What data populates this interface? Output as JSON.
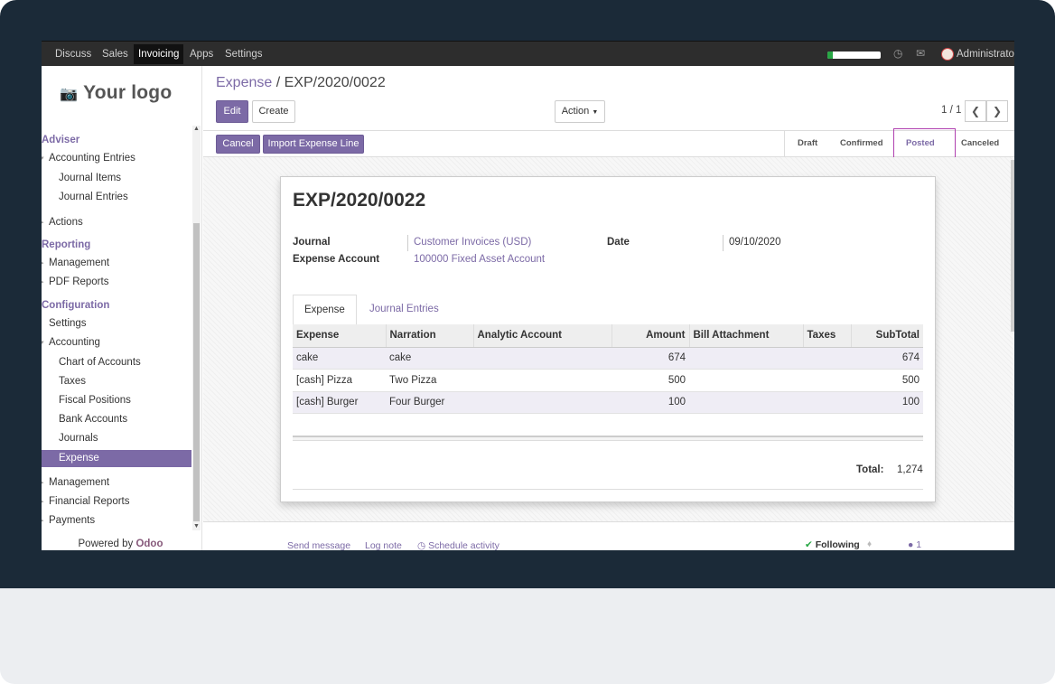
{
  "navbar": {
    "items": [
      "Discuss",
      "Sales",
      "Invoicing",
      "Apps",
      "Settings"
    ],
    "active": "Invoicing",
    "progress_fraction": 0.1,
    "user": "Administrator"
  },
  "sidebar": {
    "logo": "Your logo",
    "groups": [
      {
        "label": "Adviser"
      },
      {
        "label": "Accounting Entries"
      },
      {
        "label": "Journal Items"
      },
      {
        "label": "Journal Entries"
      },
      {
        "label": "Actions"
      },
      {
        "label": "Reporting"
      },
      {
        "label": "Management"
      },
      {
        "label": "PDF Reports"
      },
      {
        "label": "Configuration"
      },
      {
        "label": "Settings"
      },
      {
        "label": "Accounting"
      },
      {
        "label": "Chart of Accounts"
      },
      {
        "label": "Taxes"
      },
      {
        "label": "Fiscal Positions"
      },
      {
        "label": "Bank Accounts"
      },
      {
        "label": "Journals"
      },
      {
        "label": "Expense"
      },
      {
        "label": "Management"
      },
      {
        "label": "Financial Reports"
      },
      {
        "label": "Payments"
      }
    ],
    "powered_prefix": "Powered by",
    "powered_brand": "Odoo"
  },
  "breadcrumb": {
    "parent": "Expense",
    "separator": "/",
    "current": "EXP/2020/0022"
  },
  "toolbar": {
    "edit": "Edit",
    "create": "Create",
    "action": "Action",
    "pager": "1 / 1"
  },
  "statusbar": {
    "cancel": "Cancel",
    "import": "Import Expense Line",
    "stages": [
      "Draft",
      "Confirmed",
      "Posted",
      "Canceled"
    ],
    "current_stage": "Posted"
  },
  "record": {
    "title": "EXP/2020/0022",
    "journal_label": "Journal",
    "journal_value": "Customer Invoices (USD)",
    "account_label": "Expense Account",
    "account_value": "100000 Fixed Asset Account",
    "date_label": "Date",
    "date_value": "09/10/2020"
  },
  "tabs": [
    "Expense",
    "Journal Entries"
  ],
  "lines": {
    "headers": [
      "Expense",
      "Narration",
      "Analytic Account",
      "Amount",
      "Bill Attachment",
      "Taxes",
      "SubTotal"
    ],
    "rows": [
      [
        "cake",
        "cake",
        "",
        "674",
        "",
        "",
        "674"
      ],
      [
        "[cash] Pizza",
        "Two Pizza",
        "",
        "500",
        "",
        "",
        "500"
      ],
      [
        "[cash] Burger",
        "Four Burger",
        "",
        "100",
        "",
        "",
        "100"
      ]
    ]
  },
  "total": {
    "label": "Total:",
    "value": "1,274"
  },
  "chatter": {
    "send_message": "Send message",
    "log_note": "Log note",
    "schedule_activity": "Schedule activity",
    "following": "Following",
    "followers_count": "1"
  }
}
